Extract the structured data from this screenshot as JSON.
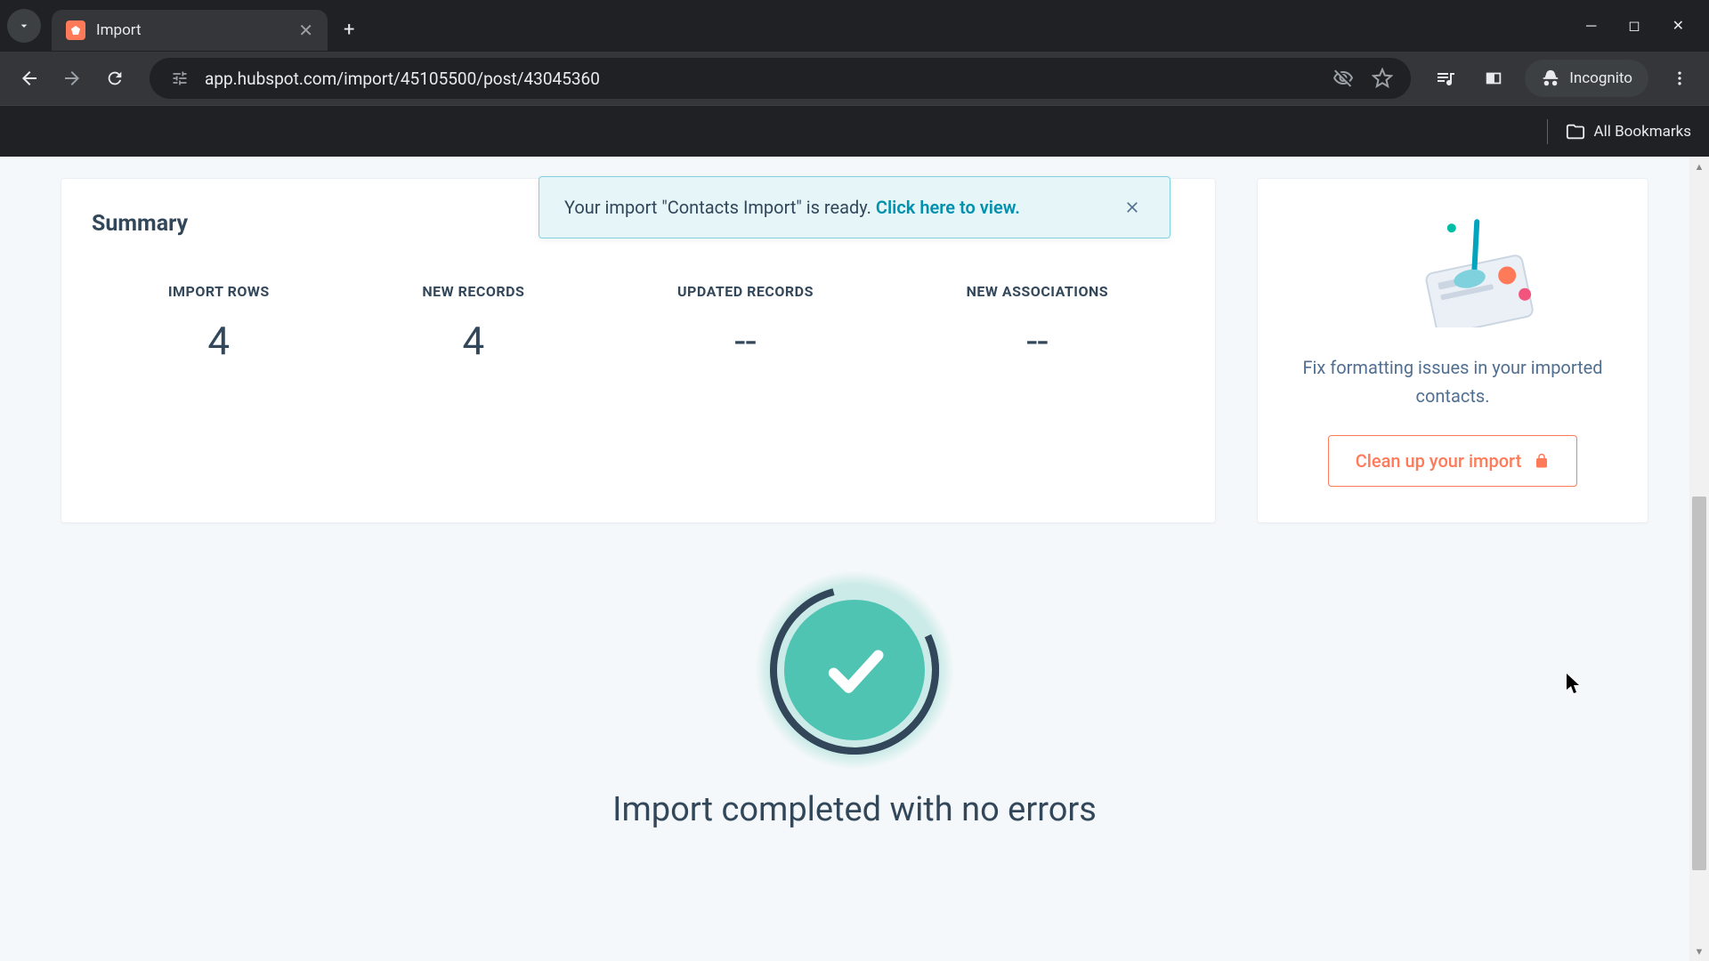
{
  "browser": {
    "tab_title": "Import",
    "url": "app.hubspot.com/import/45105500/post/43045360",
    "incognito_label": "Incognito",
    "bookmarks_label": "All Bookmarks"
  },
  "toast": {
    "text_prefix": "Your import \"Contacts Import\" is ready. ",
    "link_text": "Click here to view."
  },
  "summary": {
    "title": "Summary",
    "stats": [
      {
        "label": "IMPORT ROWS",
        "value": "4"
      },
      {
        "label": "NEW RECORDS",
        "value": "4"
      },
      {
        "label": "UPDATED RECORDS",
        "value": "--"
      },
      {
        "label": "NEW ASSOCIATIONS",
        "value": "--"
      }
    ]
  },
  "sidecard": {
    "text": "Fix formatting issues in your imported contacts.",
    "button_label": "Clean up your import"
  },
  "completion": {
    "message": "Import completed with no errors"
  },
  "colors": {
    "accent": "#ff7a59",
    "teal": "#4fc4b2",
    "link": "#0091ae"
  }
}
